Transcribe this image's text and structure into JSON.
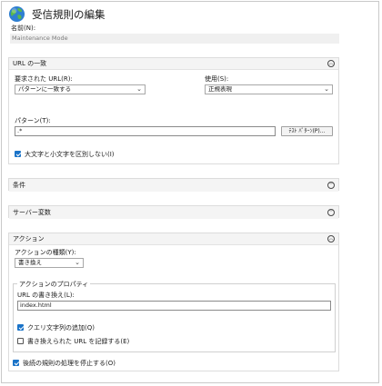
{
  "window": {
    "title": "受信規則の編集"
  },
  "name_field": {
    "label": "名前(N):",
    "value": "Maintenance Mode"
  },
  "url_match": {
    "heading": "URL の一致",
    "requested_url_label": "要求された URL(R):",
    "requested_url_value": "パターンに一致する",
    "using_label": "使用(S):",
    "using_value": "正規表現",
    "pattern_label": "パターン(T):",
    "pattern_value": ".*",
    "test_button": "ﾃｽﾄ ﾊﾟﾀｰﾝ(P)...",
    "ignore_case_label": "大文字と小文字を区別しない(I)",
    "ignore_case_checked": true
  },
  "conditions": {
    "heading": "条件"
  },
  "server_variables": {
    "heading": "サーバー変数"
  },
  "action": {
    "heading": "アクション",
    "type_label": "アクションの種類(Y):",
    "type_value": "書き換え",
    "properties_label": "アクションのプロパティ",
    "rewrite_url_label": "URL の書き換え(L):",
    "rewrite_url_value": "index.html",
    "append_query_label": "クエリ文字列の追加(Q)",
    "append_query_checked": true,
    "log_rewritten_label": "書き換えられた URL を記録する(E)",
    "log_rewritten_checked": false,
    "stop_processing_label": "後続の規則の処理を停止する(O)",
    "stop_processing_checked": true
  },
  "colors": {
    "accent": "#1a73c8",
    "section_header": "#f4f4f4",
    "readonly_field": "#f0f0f0"
  }
}
